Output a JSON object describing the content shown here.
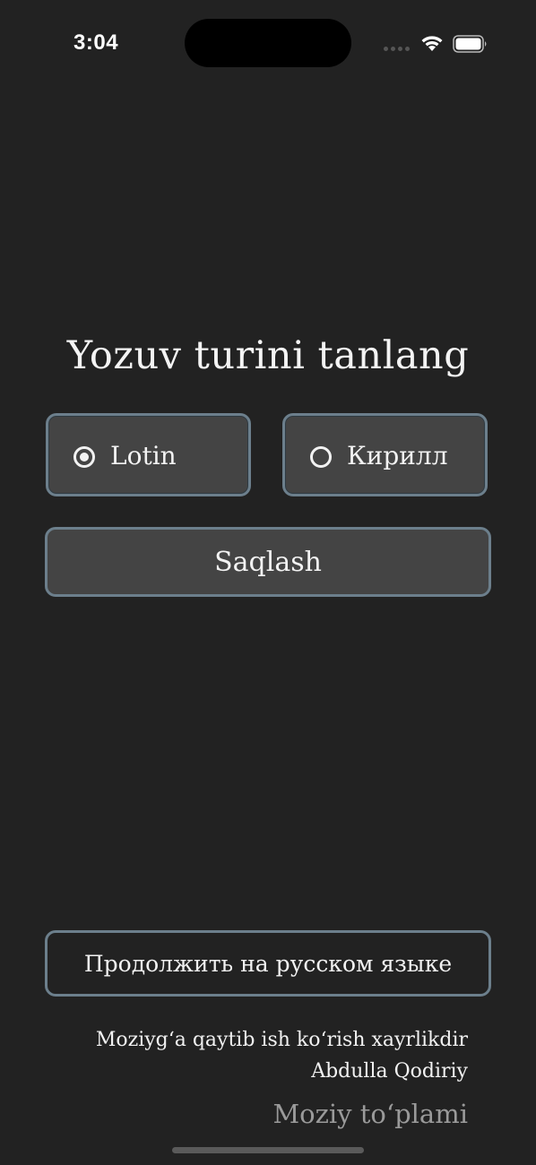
{
  "status_bar": {
    "time": "3:04",
    "icons": [
      "signal-icon",
      "wifi-icon",
      "battery-icon"
    ]
  },
  "screen": {
    "title": "Yozuv turini tanlang",
    "options": [
      {
        "label": "Lotin",
        "selected": true
      },
      {
        "label": "Кирилл",
        "selected": false
      }
    ],
    "save_label": "Saqlash",
    "russian_label": "Продолжить на русском языке",
    "quote_line1": "Moziyg‘a qaytib ish ko‘rish xayrlikdir",
    "quote_author": "Abdulla Qodiriy",
    "brand": "Moziy to‘plami"
  },
  "colors": {
    "background": "#222222",
    "button_fill": "#444444",
    "button_border": "#6c7f8c",
    "text": "#f2f2f2",
    "muted_text": "#9a9a9a"
  }
}
